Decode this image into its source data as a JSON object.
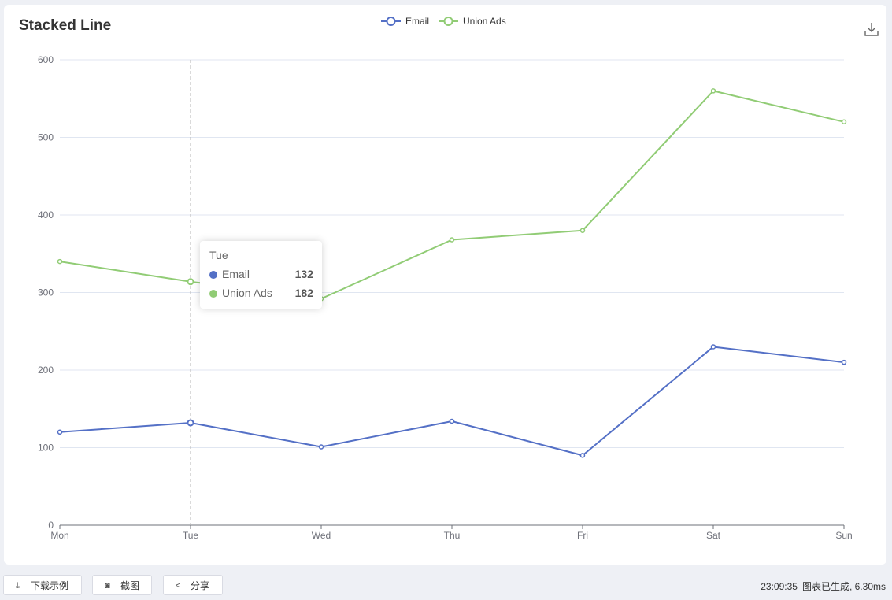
{
  "chart_data": {
    "type": "line",
    "title": "Stacked Line",
    "categories": [
      "Mon",
      "Tue",
      "Wed",
      "Thu",
      "Fri",
      "Sat",
      "Sun"
    ],
    "series": [
      {
        "name": "Email",
        "color": "#5470c6",
        "values": [
          120,
          132,
          101,
          134,
          90,
          230,
          210
        ]
      },
      {
        "name": "Union Ads",
        "color": "#91cc75",
        "values": [
          220,
          182,
          191,
          234,
          290,
          330,
          310
        ]
      }
    ],
    "stacked": true,
    "ylim": [
      0,
      600
    ],
    "yticks": [
      0,
      100,
      200,
      300,
      400,
      500,
      600
    ],
    "legend_position": "top-center",
    "grid": "horizontal",
    "tooltip": {
      "category": "Tue",
      "rows": [
        {
          "name": "Email",
          "value": "132",
          "color": "#5470c6"
        },
        {
          "name": "Union Ads",
          "value": "182",
          "color": "#91cc75"
        }
      ]
    }
  },
  "toolbar": {
    "download_icon": "download-icon"
  },
  "footer": {
    "download_label": "下载示例",
    "screenshot_label": "截图",
    "share_label": "分享",
    "time": "23:09:35",
    "status": "图表已生成, 6.30ms"
  }
}
